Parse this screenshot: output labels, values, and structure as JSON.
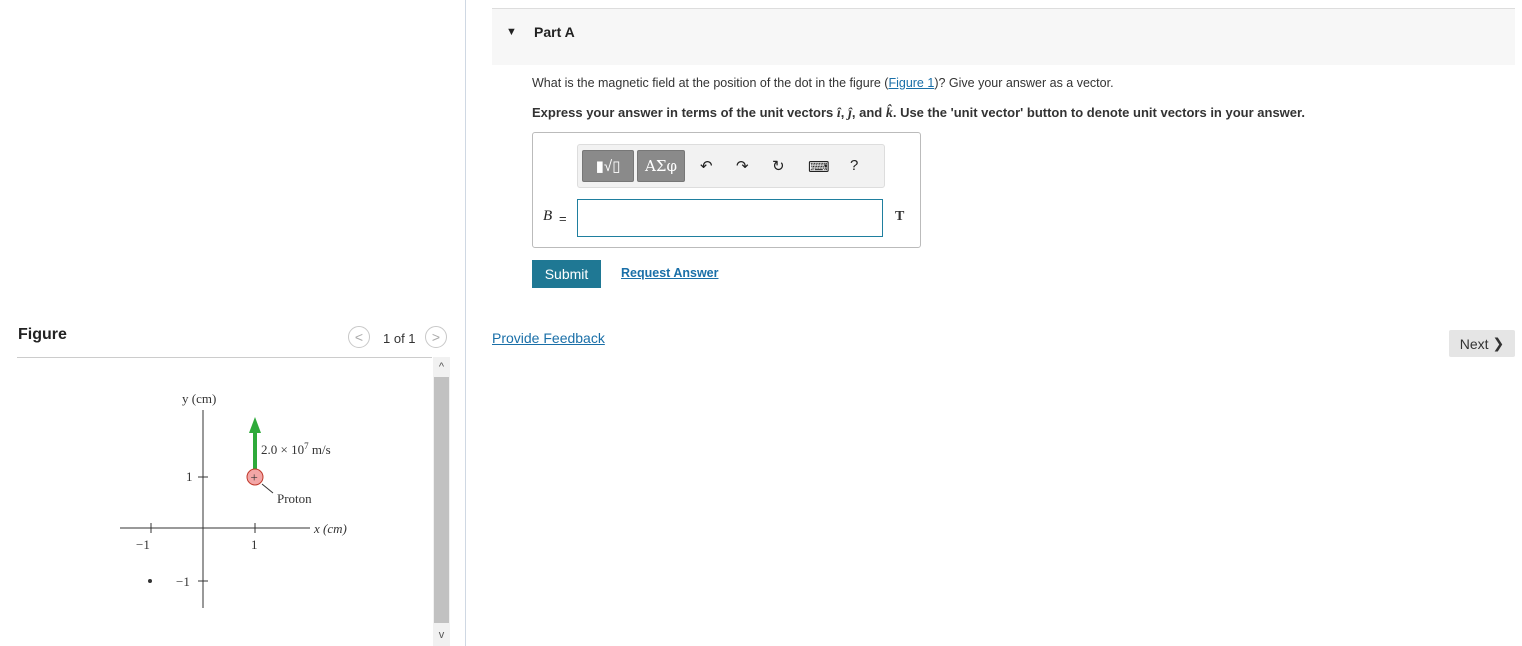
{
  "figure_panel": {
    "title": "Figure",
    "pager": "1 of 1",
    "prev_glyph": "<",
    "next_glyph": ">",
    "scroll_up_glyph": "^",
    "scroll_down_glyph": "v",
    "graph": {
      "y_axis_label": "y (cm)",
      "x_axis_label": "x (cm)",
      "y_tick_top": "1",
      "y_tick_bottom": "−1",
      "x_tick_left": "−1",
      "x_tick_right": "1",
      "velocity_label_prefix": "2.0 × 10",
      "velocity_exponent": "7",
      "velocity_unit": " m/s",
      "particle_label": "Proton",
      "charge_symbol": "+",
      "arrow_color": "#2eaa3a",
      "proton_color": "#f3a6a6"
    }
  },
  "part": {
    "caret": "▼",
    "title": "Part A",
    "question_before": "What is the magnetic field at the position of the dot in the figure (",
    "question_link": "Figure 1",
    "question_after": ")? Give your answer as a vector.",
    "instructions_before": "Express your answer in terms of the unit vectors ",
    "unit_i": "î",
    "unit_j": "ĵ",
    "unit_k": "k̂",
    "instructions_mid": ", and ",
    "instructions_after": ". Use the 'unit vector' button to denote unit vectors in your answer.",
    "comma": ", "
  },
  "toolbar": {
    "templates_glyph": "▮√▯",
    "symbols_label": "ΑΣφ",
    "undo_glyph": "↶",
    "redo_glyph": "↷",
    "reset_glyph": "↻",
    "keyboard_glyph": "⌨",
    "help_label": "?"
  },
  "answer": {
    "variable": "B⃗",
    "equals": "=",
    "value": "",
    "unit": "T"
  },
  "actions": {
    "submit": "Submit",
    "request_answer": "Request Answer",
    "provide_feedback": "Provide Feedback",
    "next": "Next",
    "next_glyph": "❯"
  },
  "colors": {
    "submit_bg": "#1f7894",
    "link": "#1a6fa8"
  }
}
